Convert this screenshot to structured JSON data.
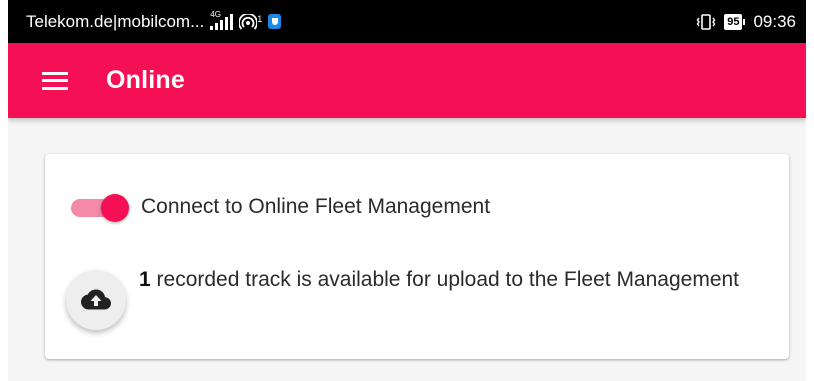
{
  "statusbar": {
    "carrier": "Telekom.de|mobilcom...",
    "network": "4G",
    "hotspot_sup": "1",
    "battery": "95",
    "time": "09:36"
  },
  "appbar": {
    "title": "Online",
    "color": "#f50f55"
  },
  "card": {
    "toggle": {
      "label": "Connect to Online Fleet Management",
      "checked": true
    },
    "upload": {
      "count": "1",
      "text": " recorded track is available for upload to the Fleet Management",
      "icon": "cloud-upload-icon"
    }
  }
}
